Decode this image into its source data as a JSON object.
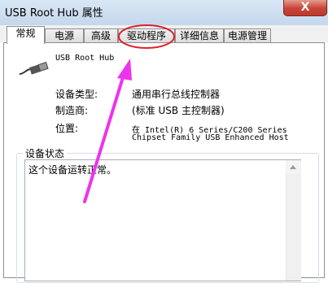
{
  "window": {
    "title": "USB Root Hub 属性",
    "close_label": "X"
  },
  "tabs": [
    {
      "label": "常规",
      "active": true
    },
    {
      "label": "电源",
      "active": false
    },
    {
      "label": "高级",
      "active": false
    },
    {
      "label": "驱动程序",
      "active": false
    },
    {
      "label": "详细信息",
      "active": false
    },
    {
      "label": "电源管理",
      "active": false
    }
  ],
  "device": {
    "name": "USB Root Hub",
    "icon": "usb-plug-icon",
    "properties": [
      {
        "label": "设备类型:",
        "value": "通用串行总线控制器"
      },
      {
        "label": "制造商:",
        "value": "(标准 USB 主控制器)"
      },
      {
        "label": "位置:",
        "value_line1": "在 Intel(R) 6 Series/C200 Series",
        "value_line2": "Chipset Family USB Enhanced Host"
      }
    ]
  },
  "status_group": {
    "title": "设备状态",
    "text": "这个设备运转正常。"
  },
  "annotation": {
    "highlight_color": "#e0202a",
    "arrow_color": "#ee33ee"
  }
}
